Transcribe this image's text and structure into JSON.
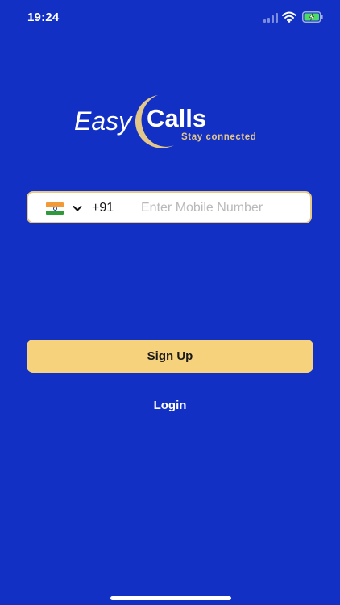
{
  "status_bar": {
    "time": "19:24",
    "icons": [
      "signal-icon",
      "wifi-icon",
      "battery-charging-icon"
    ]
  },
  "logo": {
    "word_1": "Easy",
    "word_2": "Calls",
    "tagline": "Stay connected",
    "colors": {
      "text": "#ffffff",
      "accent": "#e3c68a"
    }
  },
  "phone_form": {
    "country_flag": "india-flag-icon",
    "dial_code": "+91",
    "mobile_placeholder": "Enter Mobile Number",
    "mobile_value": ""
  },
  "actions": {
    "signup_label": "Sign Up",
    "login_label": "Login"
  },
  "colors": {
    "background": "#1230c4",
    "button": "#f6d27c",
    "field_border": "#e6c887"
  }
}
